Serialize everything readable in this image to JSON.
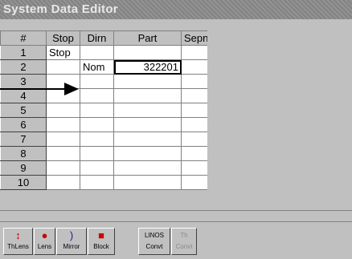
{
  "window": {
    "title": "System Data Editor"
  },
  "grid": {
    "columns": [
      "#",
      "Stop",
      "Dirn",
      "Part",
      "Sepn"
    ],
    "rows": [
      {
        "num": "1",
        "stop": "Stop",
        "dirn": "",
        "part": "",
        "sepn": ""
      },
      {
        "num": "2",
        "stop": "",
        "dirn": "Nom",
        "part": "322201",
        "sepn": ""
      },
      {
        "num": "3",
        "stop": "",
        "dirn": "",
        "part": "",
        "sepn": ""
      },
      {
        "num": "4",
        "stop": "",
        "dirn": "",
        "part": "",
        "sepn": ""
      },
      {
        "num": "5",
        "stop": "",
        "dirn": "",
        "part": "",
        "sepn": ""
      },
      {
        "num": "6",
        "stop": "",
        "dirn": "",
        "part": "",
        "sepn": ""
      },
      {
        "num": "7",
        "stop": "",
        "dirn": "",
        "part": "",
        "sepn": ""
      },
      {
        "num": "8",
        "stop": "",
        "dirn": "",
        "part": "",
        "sepn": ""
      },
      {
        "num": "9",
        "stop": "",
        "dirn": "",
        "part": "",
        "sepn": ""
      },
      {
        "num": "10",
        "stop": "",
        "dirn": "",
        "part": "",
        "sepn": ""
      }
    ]
  },
  "toolbar": {
    "buttons": [
      {
        "label": "ThLens",
        "icon": "thick-lens-icon",
        "color": "#cc0000",
        "enabled": true
      },
      {
        "label": "Lens",
        "icon": "lens-icon",
        "color": "#cc0000",
        "enabled": true
      },
      {
        "label": "Mirror",
        "icon": "mirror-icon",
        "color": "#1a1a99",
        "enabled": true
      },
      {
        "label": "Block",
        "icon": "block-icon",
        "color": "#cc0000",
        "enabled": true
      },
      {
        "label": "Convt",
        "icon": "linos-convert-icon",
        "icon_text": "LINOS",
        "color": "#000000",
        "enabled": true
      },
      {
        "label": "Convt",
        "icon": "thin-lens-convert-icon",
        "icon_text": "Th",
        "color": "#8a8a8a",
        "enabled": false
      }
    ]
  }
}
